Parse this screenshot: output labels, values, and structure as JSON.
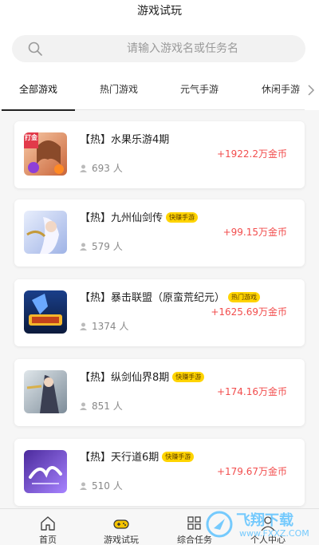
{
  "header": {
    "title": "游戏试玩"
  },
  "search": {
    "placeholder": "请输入游戏名或任务名"
  },
  "tabs": [
    {
      "label": "全部游戏",
      "active": true
    },
    {
      "label": "热门游戏"
    },
    {
      "label": "元气手游"
    },
    {
      "label": "休闲手游"
    }
  ],
  "games": [
    {
      "title": "【热】水果乐游4期",
      "tag": "",
      "count": "693 人",
      "reward": "+1922.2万金币",
      "thumb_badge": "打金"
    },
    {
      "title": "【热】九州仙剑传",
      "tag": "快赚手游",
      "count": "579 人",
      "reward": "+99.15万金币"
    },
    {
      "title": "【热】暴击联盟（原蛮荒纪元）",
      "tag": "热门游戏",
      "count": "1374 人",
      "reward": "+1625.69万金币"
    },
    {
      "title": "【热】纵剑仙界8期",
      "tag": "快赚手游",
      "count": "851 人",
      "reward": "+174.16万金币"
    },
    {
      "title": "【热】天行道6期",
      "tag": "快赚手游",
      "count": "510 人",
      "reward": "+179.67万金币"
    }
  ],
  "bottom_nav": [
    {
      "label": "首页",
      "icon": "home-icon"
    },
    {
      "label": "游戏试玩",
      "icon": "gamepad-icon"
    },
    {
      "label": "综合任务",
      "icon": "grid-icon"
    },
    {
      "label": "个人中心",
      "icon": "person-icon"
    }
  ],
  "watermark": {
    "line1": "飞翔下载",
    "line2": "www.FXXZ.COM"
  },
  "colors": {
    "reward": "#f24d4d",
    "tag_bg": "#ffd400",
    "accent_nav": "#f5c400"
  }
}
